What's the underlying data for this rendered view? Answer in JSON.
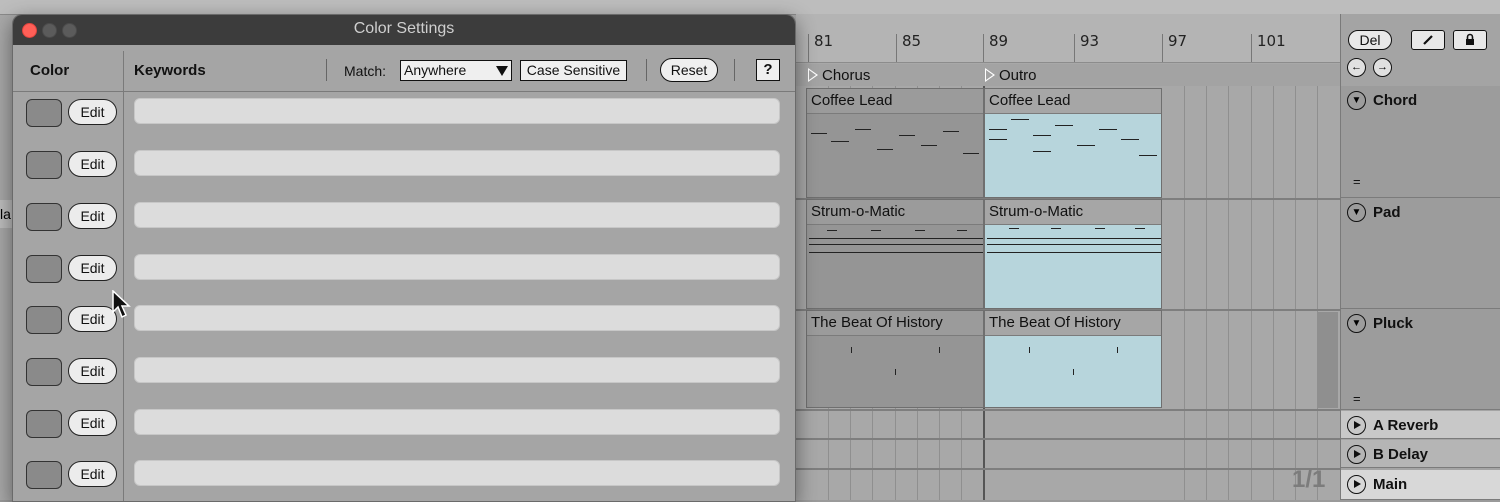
{
  "dialog": {
    "title": "Color Settings",
    "columns": {
      "color": "Color",
      "keywords": "Keywords"
    },
    "match_label": "Match:",
    "match_value": "Anywhere",
    "case_sensitive_label": "Case Sensitive",
    "reset_label": "Reset",
    "help_label": "?",
    "rows": [
      {
        "edit_label": "Edit",
        "keywords": ""
      },
      {
        "edit_label": "Edit",
        "keywords": ""
      },
      {
        "edit_label": "Edit",
        "keywords": ""
      },
      {
        "edit_label": "Edit",
        "keywords": ""
      },
      {
        "edit_label": "Edit",
        "keywords": ""
      },
      {
        "edit_label": "Edit",
        "keywords": ""
      },
      {
        "edit_label": "Edit",
        "keywords": ""
      },
      {
        "edit_label": "Edit",
        "keywords": ""
      }
    ]
  },
  "arrangement": {
    "ruler": [
      "81",
      "85",
      "89",
      "93",
      "97",
      "101"
    ],
    "locators": [
      "Chorus",
      "Outro"
    ],
    "clips": {
      "chord_a": "Coffee Lead",
      "chord_b": "Coffee Lead",
      "pad_a": "Strum-o-Matic",
      "pad_b": "Strum-o-Matic",
      "pluck_a": "The Beat Of History",
      "pluck_b": "The Beat Of History"
    },
    "page_count": "1/1",
    "left_peek_text": "la"
  },
  "right_panel": {
    "del_label": "Del",
    "tracks": [
      "Chord",
      "Pad",
      "Pluck"
    ],
    "returns": [
      "A Reverb",
      "B Delay",
      "Main"
    ],
    "eq_glyph": "="
  },
  "colors": {
    "accent_clip": "#b7d5dc",
    "close_button": "#ff5f57"
  }
}
